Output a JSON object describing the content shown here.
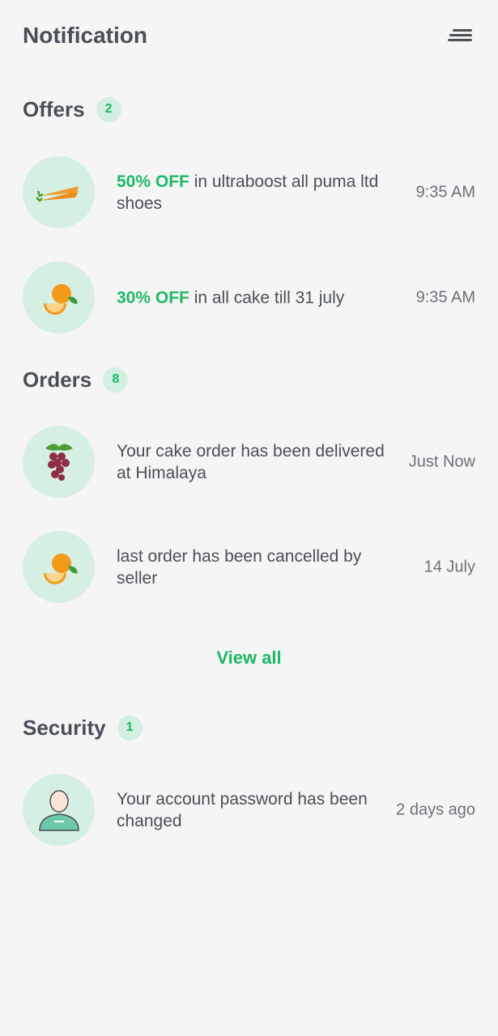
{
  "header": {
    "title": "Notification",
    "menu_icon": "menu-icon"
  },
  "colors": {
    "accent": "#1eb866",
    "badge_bg": "#d3efe1",
    "thumb_bg": "#d6efe3",
    "text": "#4a4f57"
  },
  "offers": {
    "title": "Offers",
    "count": "2",
    "items": [
      {
        "highlight": "50% OFF",
        "text": " in ultraboost all puma ltd shoes",
        "time": "9:35 AM",
        "icon": "carrot-icon"
      },
      {
        "highlight": "30% OFF",
        "text": " in all cake till 31 july",
        "time": "9:35 AM",
        "icon": "orange-icon"
      }
    ]
  },
  "orders": {
    "title": "Orders",
    "count": "8",
    "items": [
      {
        "text": "Your cake order has been delivered at Himalaya",
        "time": "Just Now",
        "icon": "grapes-icon"
      },
      {
        "text": "last order has been cancelled by seller",
        "time": "14 July",
        "icon": "orange-icon"
      }
    ],
    "view_all": "View all"
  },
  "security": {
    "title": "Security",
    "count": "1",
    "items": [
      {
        "text": "Your account password has been changed",
        "time": "2 days ago",
        "icon": "user-avatar-icon"
      }
    ]
  }
}
